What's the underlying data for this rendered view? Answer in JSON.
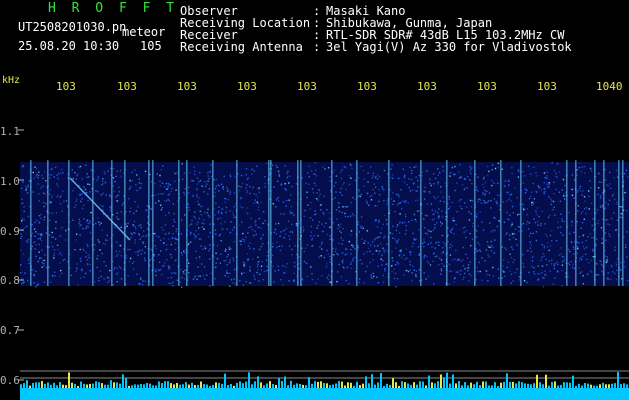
{
  "header": {
    "title": "H R O F F T",
    "filename": "UT2508201030.pn",
    "meteor_label": "meteor",
    "datetime": "25.08.20 10:30",
    "count": "105"
  },
  "info": [
    {
      "label": "Observer",
      "value": "Masaki Kano"
    },
    {
      "label": "Receiving Location",
      "value": "Shibukawa, Gunma, Japan"
    },
    {
      "label": "Receiver",
      "value": "RTL-SDR SDR# 43dB L15 103.2MHz CW"
    },
    {
      "label": "Receiving Antenna",
      "value": "3el Yagi(V) Az 330 for Vladivostok"
    }
  ],
  "axis": {
    "unit": "kHz",
    "y_ticks": [
      "1.1",
      "1.0",
      "0.9",
      "0.8",
      "0.7",
      "0.6"
    ],
    "top_labels": [
      "103",
      "103",
      "103",
      "103",
      "103",
      "103",
      "103",
      "103",
      "103",
      "1040"
    ]
  },
  "colors": {
    "band": "#0a1a8c",
    "noise_dot": "#2a6bff",
    "bright_dot": "#6fd6ff",
    "bottom_bar": "#00c8ff",
    "bottom_spike": "#e8e84a"
  }
}
